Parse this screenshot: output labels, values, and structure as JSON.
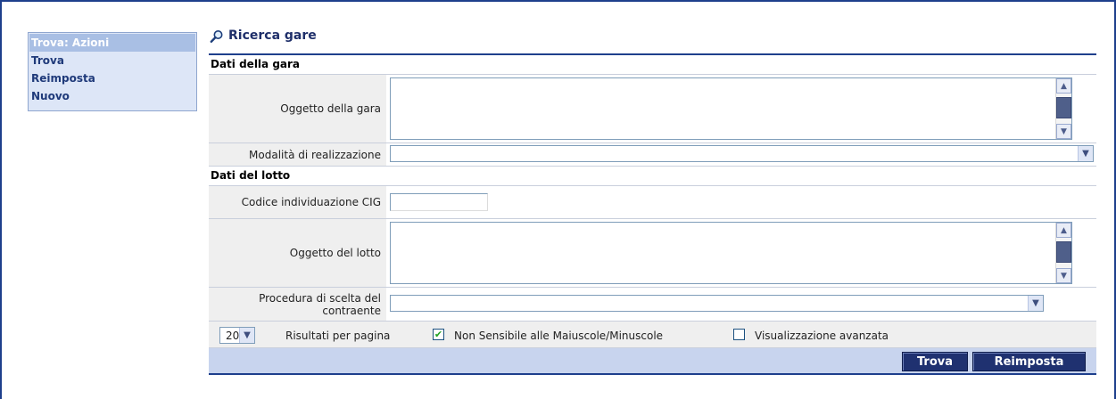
{
  "actions": {
    "title": "Trova: Azioni",
    "items": [
      "Trova",
      "Reimposta",
      "Nuovo"
    ]
  },
  "page": {
    "title": "Ricerca gare"
  },
  "sections": {
    "gara": "Dati della gara",
    "lotto": "Dati del lotto"
  },
  "fields": {
    "oggetto_gara": {
      "label": "Oggetto della gara",
      "value": ""
    },
    "modalita": {
      "label": "Modalità di realizzazione",
      "value": ""
    },
    "codice_cig": {
      "label": "Codice individuazione CIG",
      "value": ""
    },
    "oggetto_lotto": {
      "label": "Oggetto del lotto",
      "value": ""
    },
    "procedura": {
      "label": "Procedura di scelta del contraente",
      "value": ""
    }
  },
  "options": {
    "per_page_value": "20",
    "per_page_label": "Risultati per pagina",
    "case_insensitive": {
      "label": "Non Sensibile alle Maiuscole/Minuscole",
      "checked": true
    },
    "advanced_view": {
      "label": "Visualizzazione avanzata",
      "checked": false
    }
  },
  "buttons": {
    "search": "Trova",
    "reset": "Reimposta"
  },
  "colors": {
    "accent": "#1e3f8c",
    "button_bg": "#1f3170",
    "sidebar_bg": "#dde6f7",
    "label_bg": "#efefef",
    "button_bar": "#c8d4ee"
  },
  "icons": {
    "title_icon": "magnifier-icon"
  }
}
